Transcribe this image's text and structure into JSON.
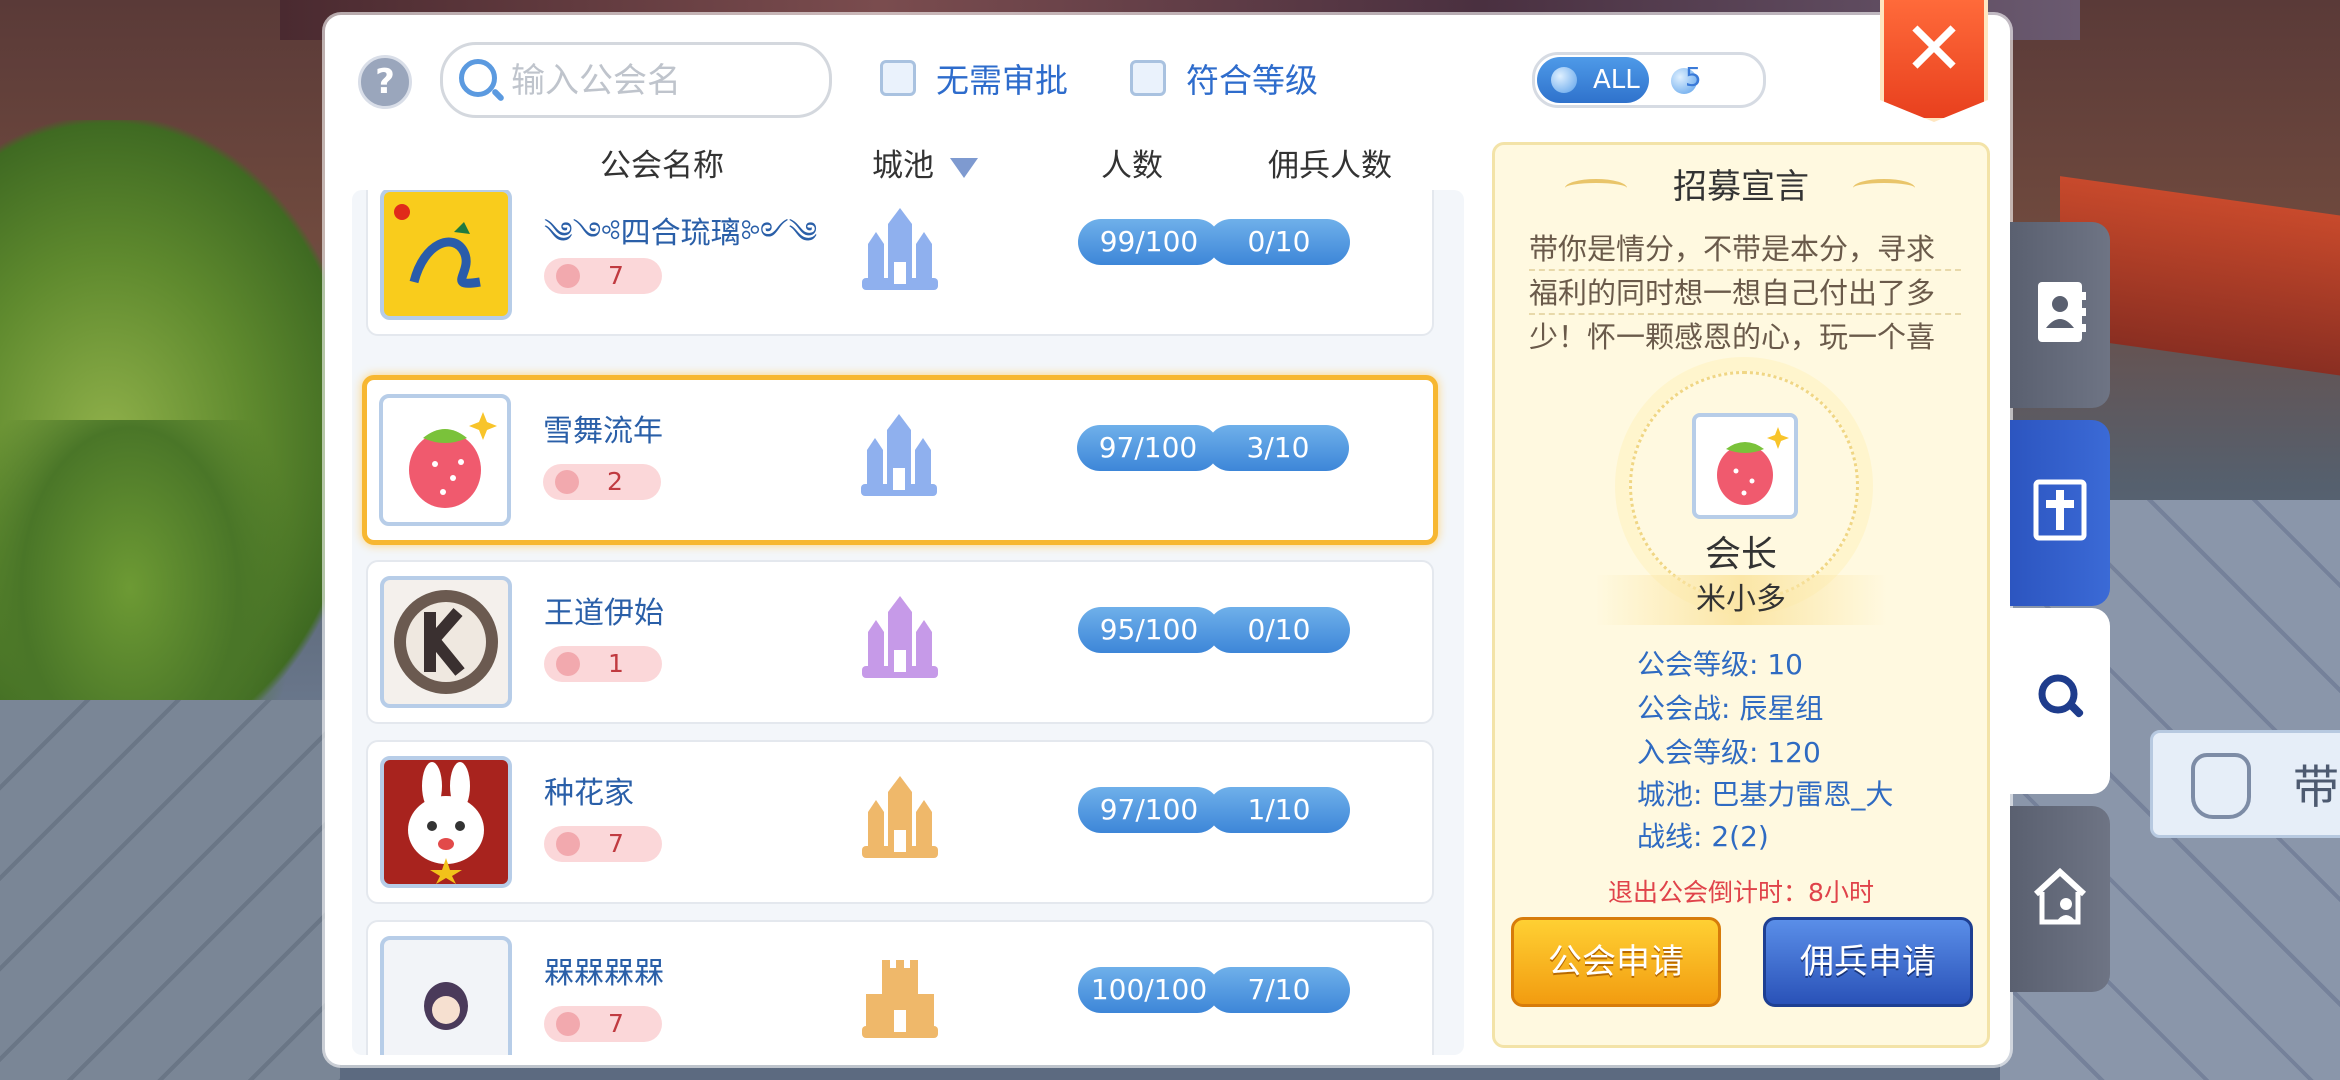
{
  "window": {
    "search_placeholder": "输入公会名",
    "filter_no_approval": "无需审批",
    "filter_match_level": "符合等级",
    "toggle_all_label": "ALL",
    "toggle_server_count": "5",
    "help_glyph": "?",
    "close_glyph": "✕"
  },
  "columns": {
    "name": "公会名称",
    "city": "城池",
    "members": "人数",
    "mercenaries": "佣兵人数"
  },
  "guilds": [
    {
      "name": "༄༺四合琉璃༻༄",
      "level": "7",
      "members": "99/100",
      "mercenaries": "0/10",
      "emblem": "dragon-flag-emblem",
      "castle_color": "#8fb0ee"
    },
    {
      "name": "雪舞流年",
      "level": "2",
      "members": "97/100",
      "mercenaries": "3/10",
      "emblem": "strawberry-emblem",
      "castle_color": "#8fb0ee",
      "selected": true
    },
    {
      "name": "王道伊始",
      "level": "1",
      "members": "95/100",
      "mercenaries": "0/10",
      "emblem": "k-logo-emblem",
      "castle_color": "#c69ae8"
    },
    {
      "name": "种花家",
      "level": "7",
      "members": "97/100",
      "mercenaries": "1/10",
      "emblem": "rabbit-emblem",
      "castle_color": "#efb86a"
    },
    {
      "name": "槑槑槑槑",
      "level": "7",
      "members": "100/100",
      "mercenaries": "7/10",
      "emblem": "character-emblem",
      "castle_color": "#efb86a"
    }
  ],
  "detail": {
    "title": "招募宣言",
    "declaration": "带你是情分，不带是本分，寻求福利的同时想一想自己付出了多少！怀一颗感恩的心，玩一个喜欢的游戏！",
    "leader_title": "会长",
    "leader_name": "米小多",
    "guild_level": "公会等级: 10",
    "guild_war": "公会战: 辰星组",
    "join_level": "入会等级: 120",
    "city": "城池: 巴基力雷恩_大",
    "battle_line": "战线: 2(2)",
    "countdown": "退出公会倒计时：8小时",
    "btn_guild_apply": "公会申请",
    "btn_merc_apply": "佣兵申请"
  },
  "side_tabs": [
    {
      "icon": "contacts-book-icon",
      "active": false
    },
    {
      "icon": "guild-cross-icon",
      "active": false
    },
    {
      "icon": "search-icon",
      "active": true
    },
    {
      "icon": "guild-house-icon",
      "active": false
    }
  ],
  "side_badge": {
    "text": "带"
  }
}
